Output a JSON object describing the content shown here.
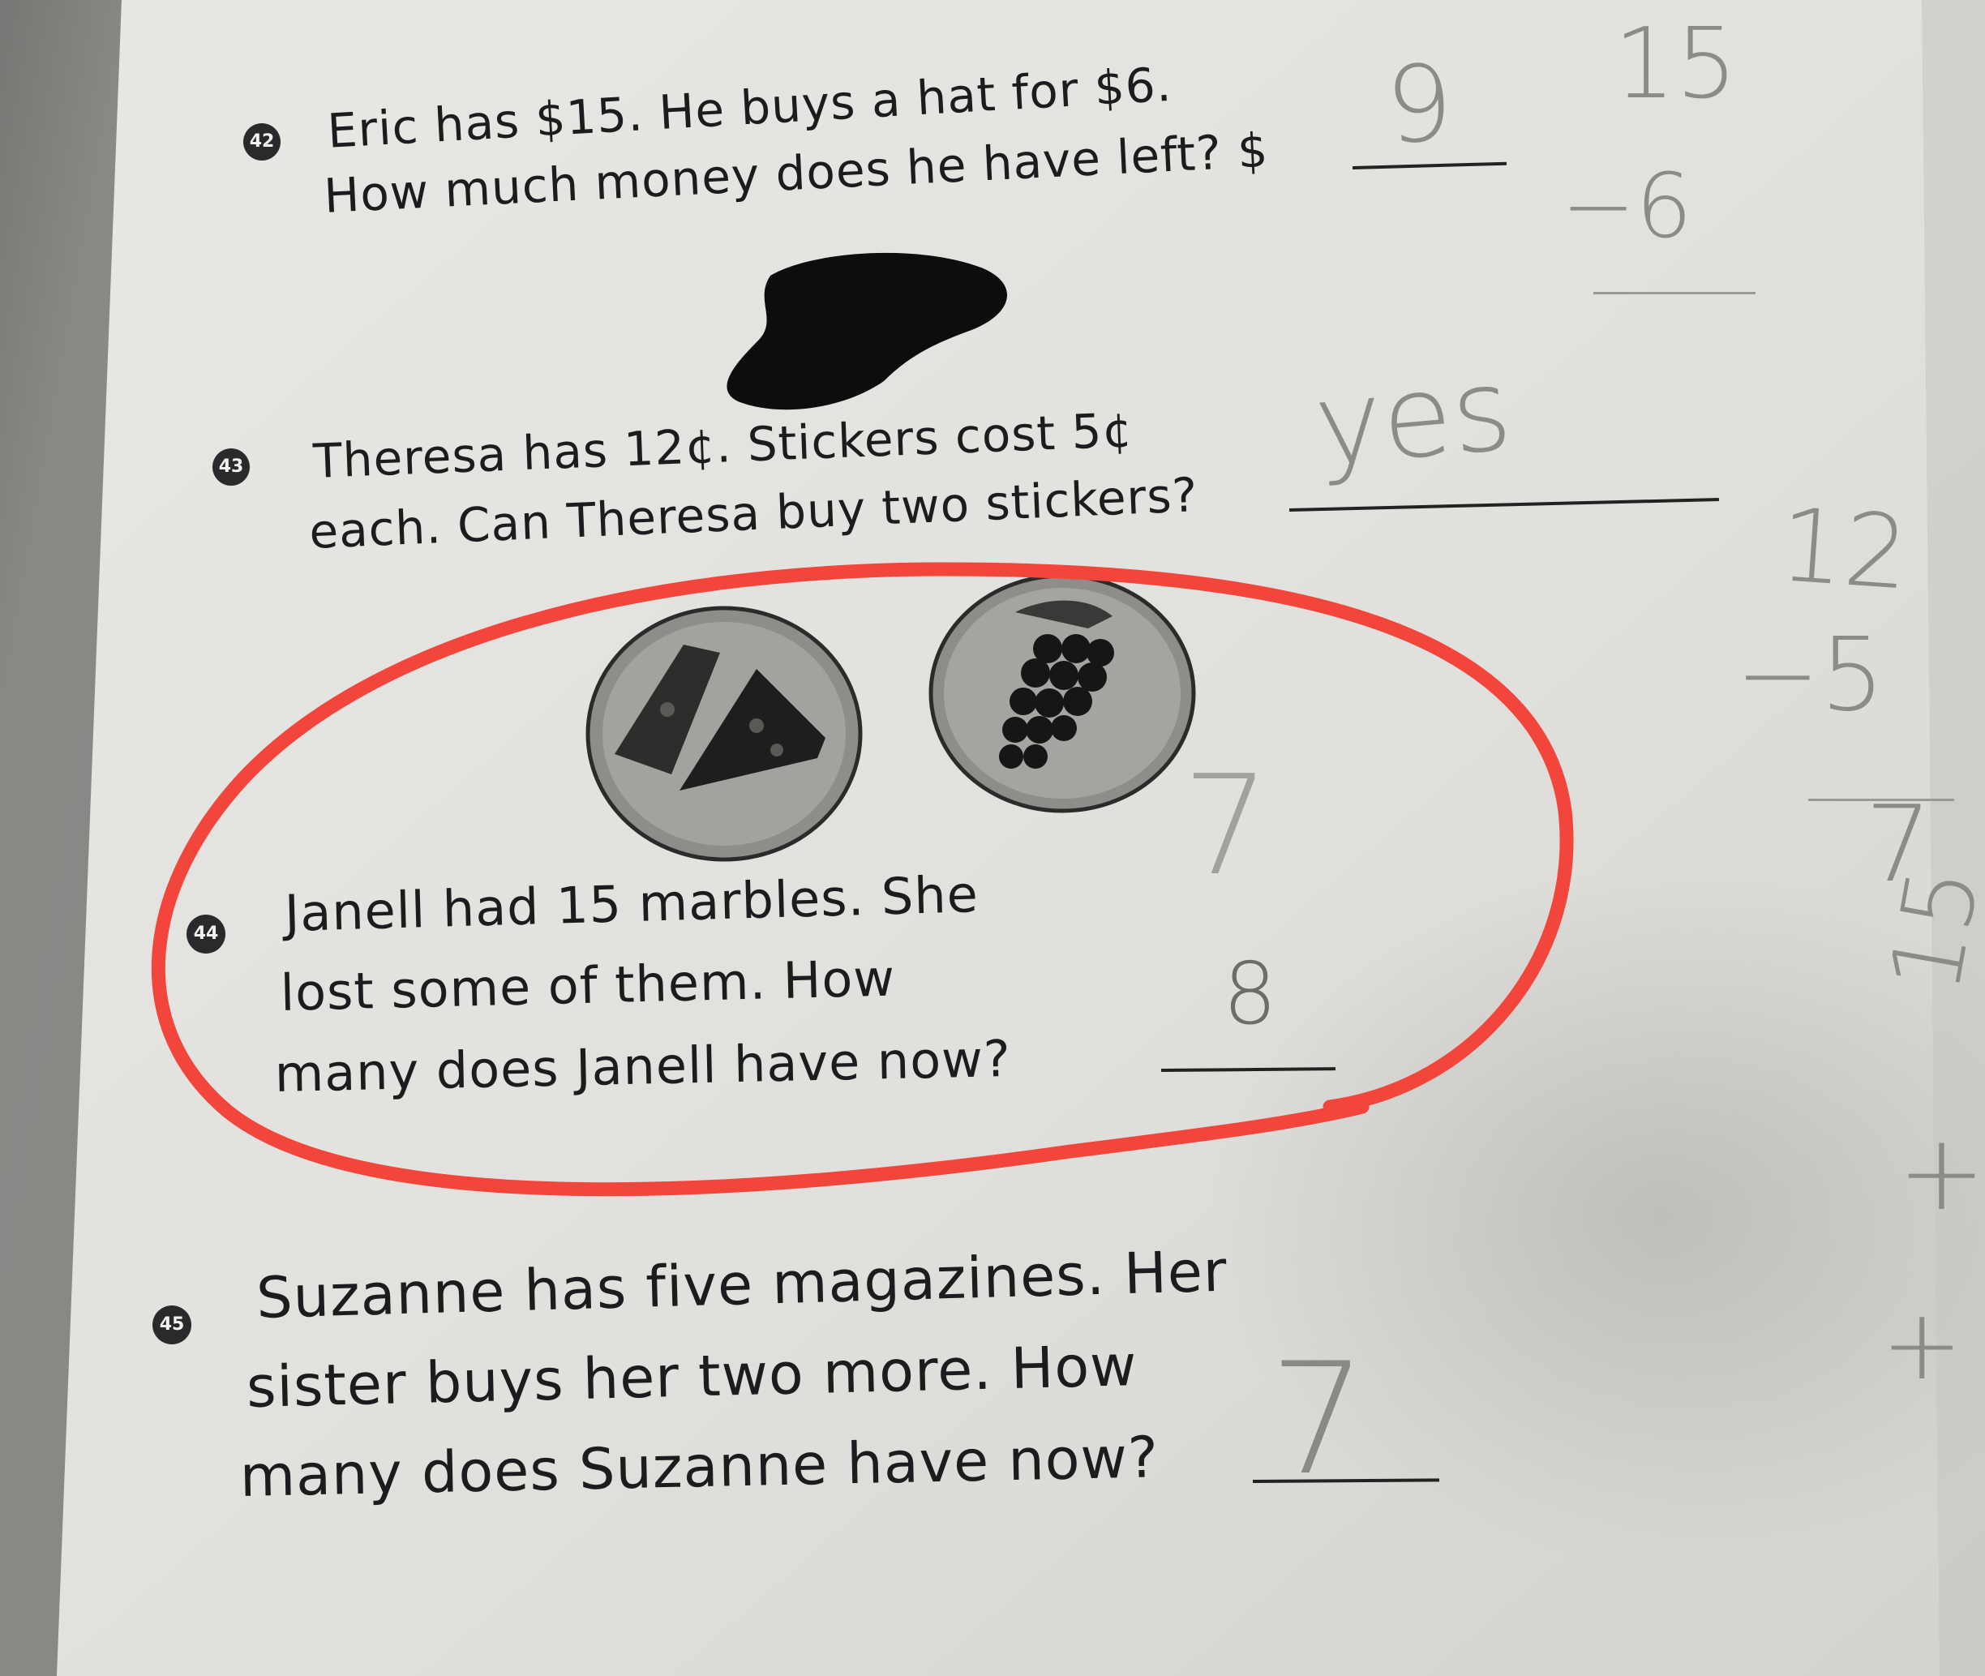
{
  "problems": [
    {
      "number": "42",
      "line1": "Eric has $15. He buys a hat for $6.",
      "line2": "How much money does he have left? $",
      "answer": "9",
      "picture": "hat-icon"
    },
    {
      "number": "43",
      "line1": "Theresa has 12¢. Stickers cost 5¢",
      "line2": "each. Can Theresa buy two stickers?",
      "answer": "yes",
      "pictures": [
        "pizza-icon",
        "grapes-icon"
      ]
    },
    {
      "number": "44",
      "line1": "Janell had 15 marbles. She",
      "line2": "lost some of them. How",
      "line3": "many does Janell have now?",
      "answer": "",
      "scribbles": [
        "7",
        "8"
      ]
    },
    {
      "number": "45",
      "line1": "Suzanne has five magazines. Her",
      "line2": "sister buys her two more. How",
      "line3": "many does Suzanne have now?",
      "answer": "7"
    }
  ],
  "margin_work": {
    "top_number": "15",
    "minus_1": "−6",
    "mid_number": "12",
    "minus_2": "−5",
    "result": "7",
    "bottom": "15",
    "scribble_a": "+",
    "scribble_b": "+"
  },
  "highlight_color": "#f2453b",
  "ink_color": "#1c1c1e",
  "pencil_color": "#8c8b86"
}
